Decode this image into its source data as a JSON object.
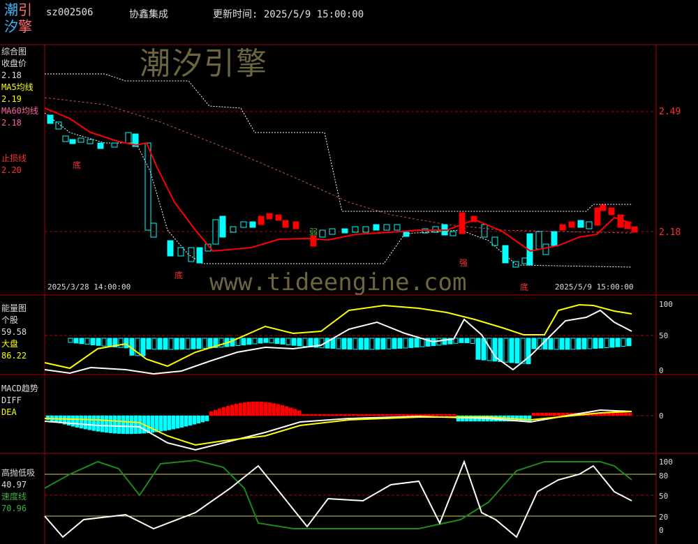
{
  "header": {
    "logo": [
      "潮",
      "引",
      "汐",
      "擎"
    ],
    "code": "sz002506",
    "name": "协鑫集成",
    "update_time": "更新时间: 2025/5/9 15:00:00"
  },
  "watermark": {
    "brand": "潮汐引擎",
    "url": "www.tideengine.com"
  },
  "panel_main": {
    "title": "综合图",
    "close_label": "收盘价",
    "close_value": "2.18",
    "ma5_label": "MA5均线",
    "ma5_value": "2.19",
    "ma60_label": "MA60均线",
    "ma60_value": "2.18",
    "stop_label": "止损线",
    "stop_value": "2.20",
    "right_top": "2.49",
    "right_bottom": "2.18",
    "date_start": "2025/3/28 14:00:00",
    "date_end": "2025/5/9 15:00:00",
    "marks": [
      "底",
      "底",
      "强",
      "底",
      "弱"
    ]
  },
  "panel_energy": {
    "title": "能量图",
    "stock_label": "个股",
    "stock_value": "59.58",
    "market_label": "大盘",
    "market_value": "86.22",
    "ticks": [
      "100",
      "50",
      "0"
    ]
  },
  "panel_macd": {
    "title": "MACD趋势",
    "diff_label": "DIFF",
    "dea_label": "DEA",
    "ticks": [
      "0"
    ]
  },
  "panel_swing": {
    "title": "高抛低吸",
    "value1": "40.97",
    "speed_label": "速度线",
    "speed_value": "70.96",
    "ticks": [
      "100",
      "80",
      "50",
      "20",
      "0"
    ]
  },
  "colors": {
    "cyan": "#00ffff",
    "red": "#ff0000",
    "yellow": "#ffff00",
    "white": "#ffffff",
    "green": "#1a8a1a",
    "frame": "#b00000"
  }
}
